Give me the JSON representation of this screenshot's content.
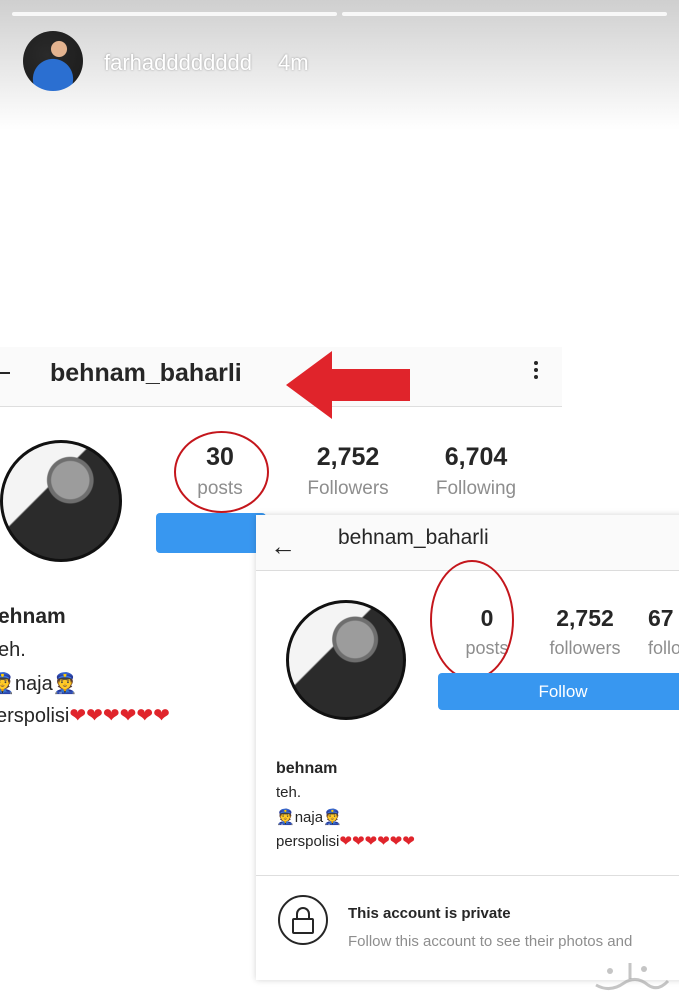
{
  "story": {
    "username": "farhadddddddd",
    "time": "4m"
  },
  "screenshot_old": {
    "username": "behnam_baharli",
    "stats": {
      "posts_count": "30",
      "posts_label": "posts",
      "followers_count": "2,752",
      "followers_label": "Followers",
      "following_count": "6,704",
      "following_label": "Following"
    },
    "bio": {
      "name": "ehnam",
      "line1": "eh.",
      "line2": "naja",
      "line3_text": "erspolisi",
      "line3_hearts": "❤❤❤❤❤❤"
    }
  },
  "screenshot_new": {
    "username": "behnam_baharli",
    "stats": {
      "posts_count": "0",
      "posts_label": "posts",
      "followers_count": "2,752",
      "followers_label": "followers",
      "following_count": "67",
      "following_label": "follo"
    },
    "follow_label": "Follow",
    "bio": {
      "name": "behnam",
      "line1": "teh.",
      "line2": "naja",
      "line3_text": "perspolisi",
      "line3_hearts": "❤❤❤❤❤❤"
    },
    "private_title": "This account is private",
    "private_subtitle": "Follow this account to see their photos and"
  },
  "colors": {
    "highlight_red": "#c4161c",
    "arrow_red": "#e0242b",
    "follow_blue": "#3897f0"
  },
  "icons": [
    "back-arrow-icon",
    "more-options-icon",
    "lock-icon",
    "red-arrow-icon",
    "police-emoji-icon",
    "heart-icon"
  ]
}
